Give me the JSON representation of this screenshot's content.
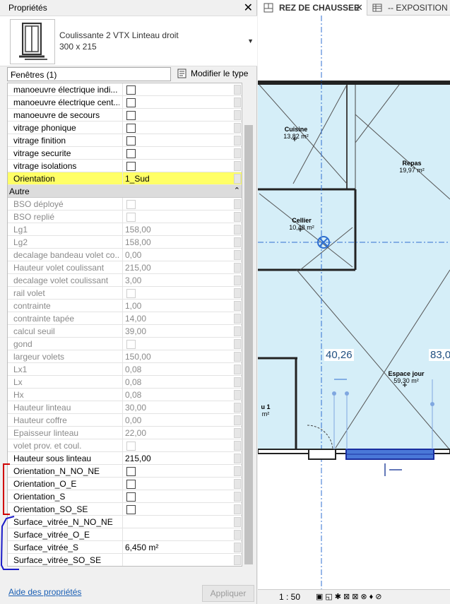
{
  "palette": {
    "title": "Propriétés",
    "close_icon": "close-icon",
    "type_name": "Coulissante 2 VTX Linteau droit",
    "type_size": "300 x 215",
    "category_filter": "Fenêtres (1)",
    "modify_type_label": "Modifier le type",
    "help_link": "Aide des propriétés",
    "apply_label": "Appliquer"
  },
  "params": [
    {
      "name": "manoeuvre électrique indi...",
      "value": "",
      "check": true
    },
    {
      "name": "manoeuvre électrique cent...",
      "value": "",
      "check": true
    },
    {
      "name": "manoeuvre de secours",
      "value": "",
      "check": true
    },
    {
      "name": "vitrage phonique",
      "value": "",
      "check": true
    },
    {
      "name": "vitrage finition",
      "value": "",
      "check": true
    },
    {
      "name": "vitrage securite",
      "value": "",
      "check": true
    },
    {
      "name": "vitrage isolations",
      "value": "",
      "check": true
    },
    {
      "name": "Orientation",
      "value": "1_Sud",
      "highlight": true
    },
    {
      "section": "Autre"
    },
    {
      "name": "BSO déployé",
      "value": "",
      "check": true,
      "disabled": true
    },
    {
      "name": "BSO replié",
      "value": "",
      "check": true,
      "disabled": true
    },
    {
      "name": "Lg1",
      "value": "158,00",
      "disabled": true
    },
    {
      "name": "Lg2",
      "value": "158,00",
      "disabled": true
    },
    {
      "name": "decalage bandeau volet co...",
      "value": "0,00",
      "disabled": true
    },
    {
      "name": "Hauteur volet coulissant",
      "value": "215,00",
      "disabled": true
    },
    {
      "name": "decalage volet coulissant",
      "value": "3,00",
      "disabled": true
    },
    {
      "name": "rail volet",
      "value": "",
      "check": true,
      "disabled": true
    },
    {
      "name": "contrainte",
      "value": "1,00",
      "disabled": true
    },
    {
      "name": "contrainte tapée",
      "value": "14,00",
      "disabled": true
    },
    {
      "name": "calcul seuil",
      "value": "39,00",
      "disabled": true
    },
    {
      "name": "gond",
      "value": "",
      "check": true,
      "disabled": true
    },
    {
      "name": "largeur volets",
      "value": "150,00",
      "disabled": true
    },
    {
      "name": "Lx1",
      "value": "0,08",
      "disabled": true
    },
    {
      "name": "Lx",
      "value": "0,08",
      "disabled": true
    },
    {
      "name": "Hx",
      "value": "0,08",
      "disabled": true
    },
    {
      "name": "Hauteur linteau",
      "value": "30,00",
      "disabled": true
    },
    {
      "name": "Hauteur coffre",
      "value": "0,00",
      "disabled": true
    },
    {
      "name": "Epaisseur linteau",
      "value": "22,00",
      "disabled": true
    },
    {
      "name": "volet prov. et coul.",
      "value": "",
      "check": true,
      "disabled": true
    },
    {
      "name": "Hauteur sous linteau",
      "value": "215,00"
    },
    {
      "name": "Orientation_N_NO_NE",
      "value": "",
      "check": true
    },
    {
      "name": "Orientation_O_E",
      "value": "",
      "check": true
    },
    {
      "name": "Orientation_S",
      "value": "",
      "check": true
    },
    {
      "name": "Orientation_SO_SE",
      "value": "",
      "check": true
    },
    {
      "name": "Surface_vitrée_N_NO_NE",
      "value": ""
    },
    {
      "name": "Surface_vitrée_O_E",
      "value": ""
    },
    {
      "name": "Surface_vitrée_S",
      "value": "6,450 m²"
    },
    {
      "name": "Surface_vitrée_SO_SE",
      "value": ""
    }
  ],
  "view": {
    "tab_active": "REZ DE CHAUSSEE",
    "tab_other": "-- EXPOSITION S",
    "scale": "1 : 50",
    "rooms": [
      {
        "name": "Cuisine",
        "area": "13,82 m²"
      },
      {
        "name": "Repas",
        "area": "19,97 m²"
      },
      {
        "name": "Cellier",
        "area": "10,48 m²"
      },
      {
        "name": "Espace jour",
        "area": "59,30 m²"
      },
      {
        "name": "u 1",
        "area": "m²"
      }
    ],
    "dims": [
      "40,26",
      "83,0"
    ]
  }
}
